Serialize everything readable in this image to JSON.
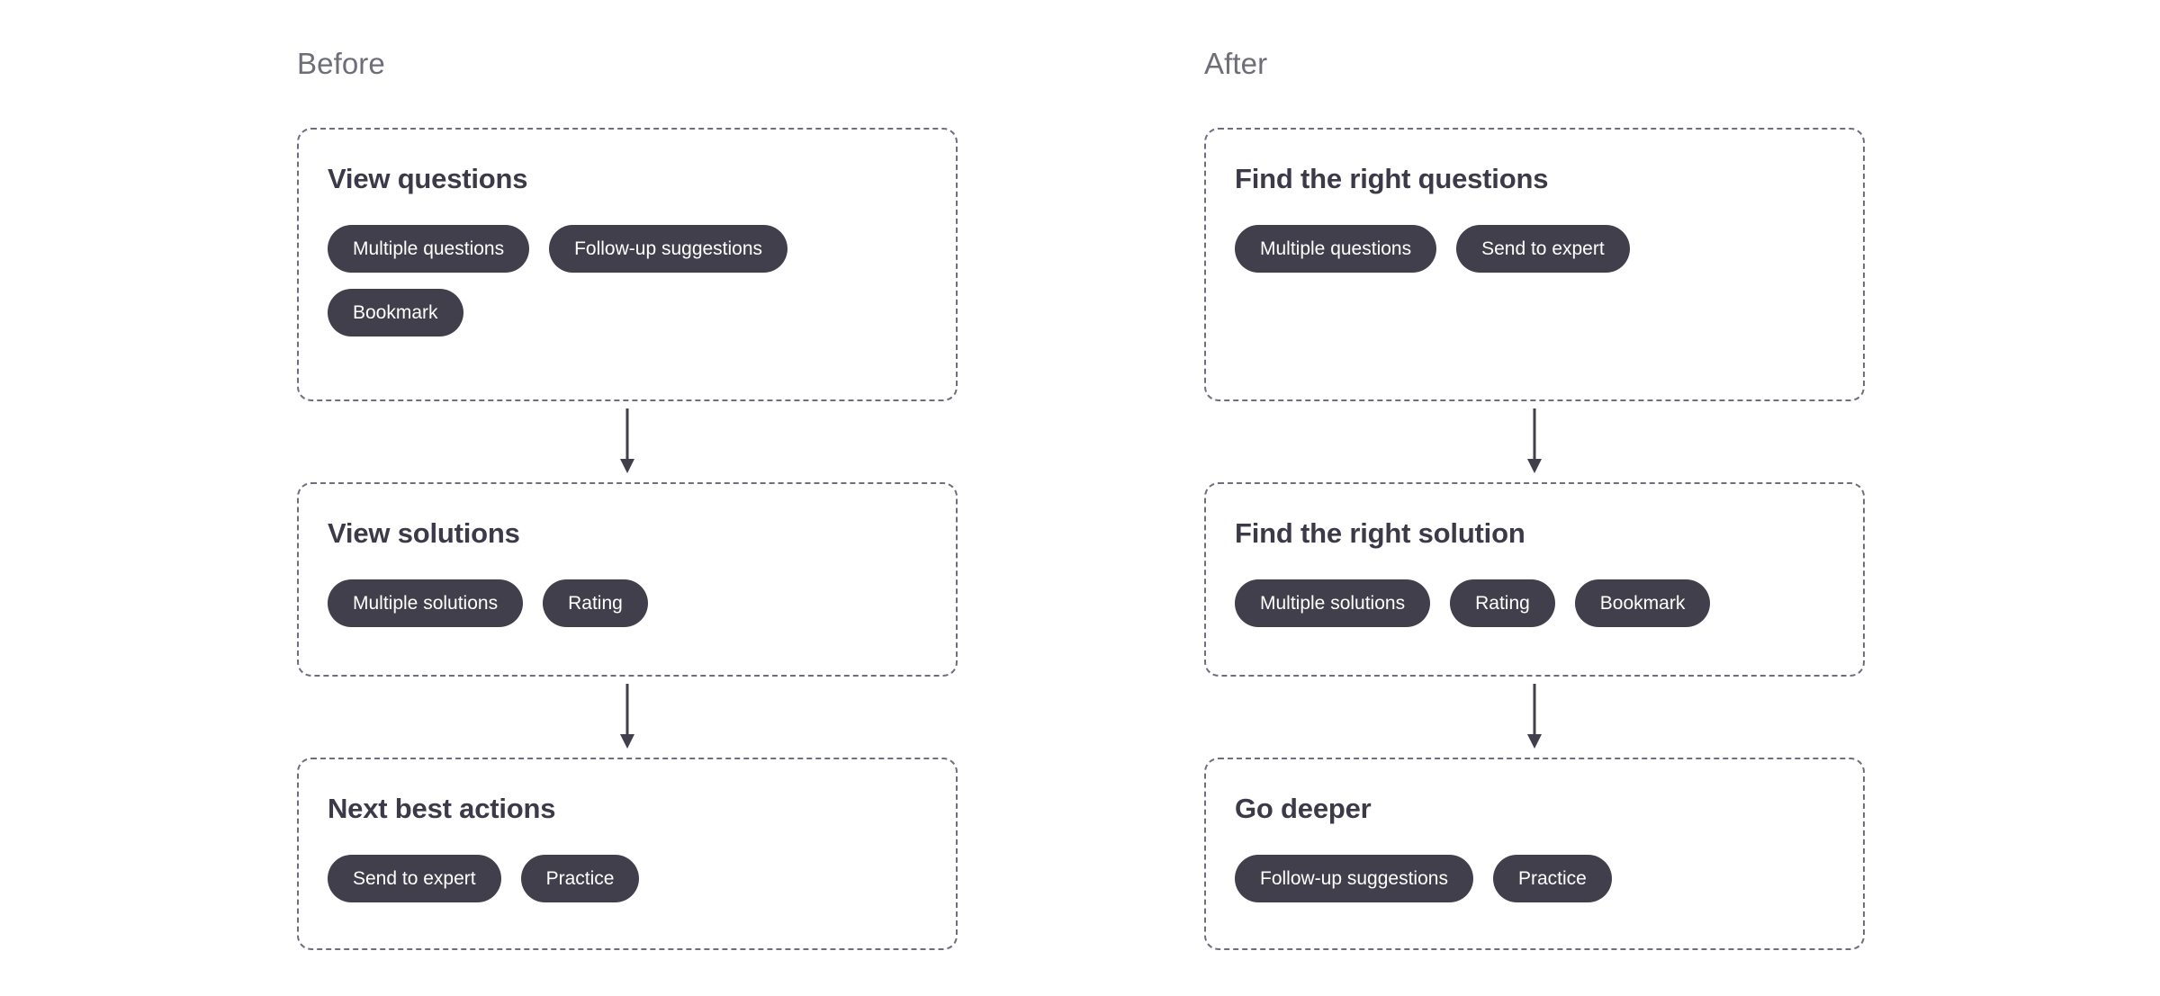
{
  "page": {
    "background_color": "#ffffff",
    "title": "Before and After user flow comparison"
  },
  "theme": {
    "pill_background": "#413f4b",
    "pill_text": "#ffffff",
    "heading_color": "#3c3a48",
    "label_color": "#6e6e79",
    "border_color": "#6e6e7e",
    "arrow_color": "#413f4b"
  },
  "columns": [
    {
      "label": "Before",
      "stages": [
        {
          "title": "View questions",
          "pills": [
            "Multiple questions",
            "Follow-up suggestions",
            "Bookmark"
          ]
        },
        {
          "title": "View solutions",
          "pills": [
            "Multiple solutions",
            "Rating"
          ]
        },
        {
          "title": "Next best actions",
          "pills": [
            "Send to expert",
            "Practice"
          ]
        }
      ]
    },
    {
      "label": "After",
      "stages": [
        {
          "title": "Find the right questions",
          "pills": [
            "Multiple questions",
            "Send to expert"
          ]
        },
        {
          "title": "Find the right solution",
          "pills": [
            "Multiple solutions",
            "Rating",
            "Bookmark"
          ]
        },
        {
          "title": "Go deeper",
          "pills": [
            "Follow-up suggestions",
            "Practice"
          ]
        }
      ]
    }
  ],
  "connectors": {
    "icon": "arrow-down-icon",
    "count_per_column": 2
  }
}
